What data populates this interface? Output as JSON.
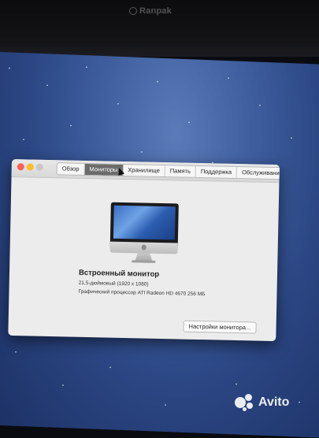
{
  "watermark": {
    "top_text": "Ranpak",
    "bottom_text": "Avito"
  },
  "window": {
    "tabs": [
      {
        "label": "Обзор",
        "active": false
      },
      {
        "label": "Мониторы",
        "active": true
      },
      {
        "label": "Хранилище",
        "active": false
      },
      {
        "label": "Память",
        "active": false
      },
      {
        "label": "Поддержка",
        "active": false
      },
      {
        "label": "Обслуживание",
        "active": false
      }
    ],
    "monitor": {
      "title": "Встроенный монитор",
      "size": "21,5-дюймовый (1920 x 1080)",
      "graphics": "Графический процессор ATI Radeon HD 4670 256 МБ"
    },
    "settings_button": "Настройки монитора..."
  },
  "colors": {
    "close": "#ff5f57",
    "minimize": "#febc2e",
    "active_tab": "#6b6b6b",
    "desktop": "#3f5f9f"
  }
}
